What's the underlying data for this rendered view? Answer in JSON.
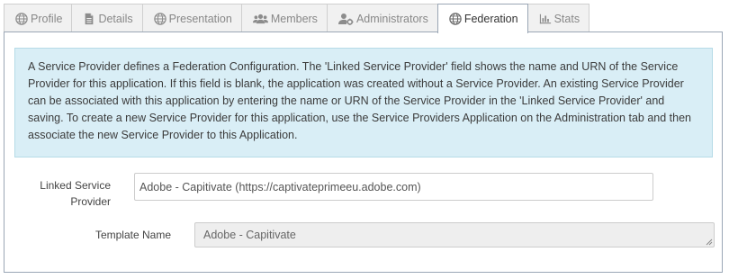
{
  "tabs": [
    {
      "label": "Profile",
      "icon": "globe-icon",
      "active": false
    },
    {
      "label": "Details",
      "icon": "document-icon",
      "active": false
    },
    {
      "label": "Presentation",
      "icon": "globe-icon",
      "active": false
    },
    {
      "label": "Members",
      "icon": "users-icon",
      "active": false
    },
    {
      "label": "Administrators",
      "icon": "user-cog-icon",
      "active": false
    },
    {
      "label": "Federation",
      "icon": "globe-icon",
      "active": true
    },
    {
      "label": "Stats",
      "icon": "bar-chart-icon",
      "active": false
    }
  ],
  "info": {
    "text": "A Service Provider defines a Federation Configuration. The 'Linked Service Provider' field shows the name and URN of the Service Provider for this application. If this field is blank, the application was created without a Service Provider. An existing Service Provider can be associated with this application by entering the name or URN of the Service Provider in the 'Linked Service Provider' and saving. To create a new Service Provider for this application, use the Service Providers Application on the Administration tab and then associate the new Service Provider to this Application."
  },
  "form": {
    "linked_sp": {
      "label": "Linked Service Provider",
      "value": "Adobe - Capitivate (https://captivateprimeeu.adobe.com)"
    },
    "template": {
      "label": "Template Name",
      "value": "Adobe - Capitivate"
    }
  },
  "colors": {
    "info_bg": "#d9eef6",
    "panel_border": "#9aa6b5"
  }
}
